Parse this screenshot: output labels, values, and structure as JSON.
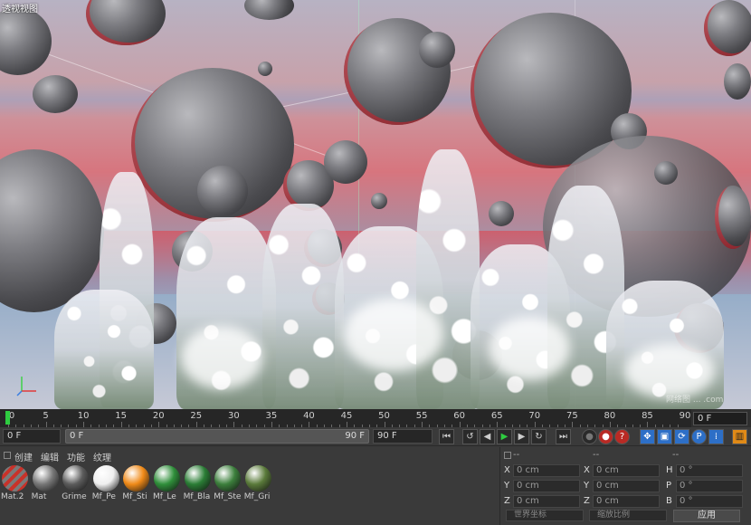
{
  "viewport": {
    "title": "透视视图",
    "watermark": "网络图 ... .com"
  },
  "timeline": {
    "ticks": [
      "0",
      "5",
      "10",
      "15",
      "20",
      "25",
      "30",
      "35",
      "40",
      "45",
      "50",
      "55",
      "60",
      "65",
      "70",
      "75",
      "80",
      "85",
      "90"
    ],
    "current_frame": "0 F",
    "playhead_value": 0
  },
  "transport": {
    "start_field": "0 F",
    "range_start": "0 F",
    "range_end": "90 F",
    "end_field": "90 F",
    "buttons": [
      "go-start",
      "prev-key",
      "prev-frame",
      "play",
      "next-frame",
      "next-key",
      "go-end",
      "record-off",
      "record",
      "autokey-help",
      "move-tool",
      "scale-key",
      "rotate-key",
      "param-key",
      "pla-key",
      "timeline-menu"
    ]
  },
  "material_panel": {
    "menu": [
      "创建",
      "编辑",
      "功能",
      "纹理"
    ],
    "materials": [
      {
        "label": "Mat.2",
        "color": "#c8322a"
      },
      {
        "label": "Mat",
        "color": "#777777"
      },
      {
        "label": "Grime",
        "color": "#5c5c5c"
      },
      {
        "label": "Mf_Pe",
        "color": "#efefef"
      },
      {
        "label": "Mf_Sti",
        "color": "#f08a18"
      },
      {
        "label": "Mf_Le",
        "color": "#2f8f3a"
      },
      {
        "label": "Mf_Bla",
        "color": "#2a7d35"
      },
      {
        "label": "Mf_Ste",
        "color": "#3c7f3c"
      },
      {
        "label": "Mf_Gri",
        "color": "#5a7a3a"
      }
    ]
  },
  "coordinates": {
    "headers": [
      "--",
      "--",
      "--"
    ],
    "rows": [
      {
        "a1": "X",
        "v1": "0 cm",
        "a2": "X",
        "v2": "0 cm",
        "a3": "H",
        "v3": "0 °"
      },
      {
        "a1": "Y",
        "v1": "0 cm",
        "a2": "Y",
        "v2": "0 cm",
        "a3": "P",
        "v3": "0 °"
      },
      {
        "a1": "Z",
        "v1": "0 cm",
        "a2": "Z",
        "v2": "0 cm",
        "a3": "B",
        "v3": "0 °"
      }
    ],
    "mode_select": "世界坐标",
    "scale_select": "缩放比例",
    "apply_label": "应用"
  },
  "colors": {
    "playhead": "#2ecc40",
    "play_button": "#2ecc40",
    "record_button": "#d8332a",
    "accent_blue": "#2d6fc7",
    "accent_orange": "#e08a17"
  }
}
